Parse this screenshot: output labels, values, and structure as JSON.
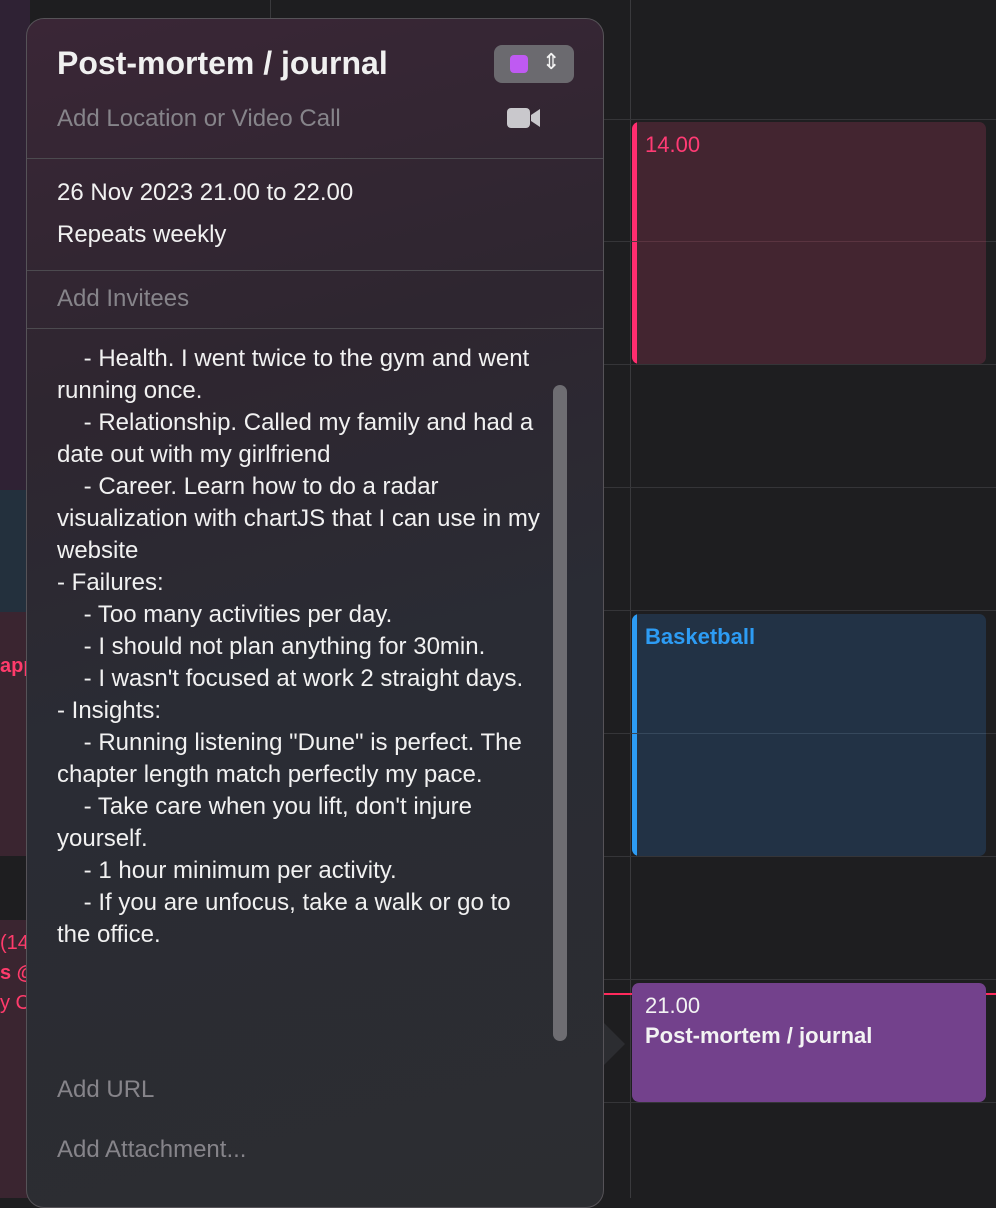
{
  "popover": {
    "title": "Post-mortem / journal",
    "calendar_color": "#bf5af2",
    "location_placeholder": "Add Location or Video Call",
    "date_time": "26 Nov 2023  21.00 to 22.00",
    "repeat": "Repeats weekly",
    "invitees_placeholder": "Add Invitees",
    "notes": "    - Health. I went twice to the gym and went running once.\n    - Relationship. Called my family and had a date out with my girlfriend\n    - Career. Learn how to do a radar visualization with chartJS that I can use in my website\n- Failures:\n    - Too many activities per day.\n    - I should not plan anything for 30min.\n    - I wasn't focused at work 2 straight days.\n- Insights:\n    - Running listening \"Dune\" is perfect. The chapter length match perfectly my pace.\n    - Take care when you lift, don't injure yourself.\n    - 1 hour minimum per activity.\n    - If you are unfocus, take a walk or go to the office.",
    "url_placeholder": "Add URL",
    "attachment_placeholder": "Add Attachment..."
  },
  "calendar": {
    "events": [
      {
        "time": "14.00",
        "title": "",
        "color": "#ff2d6f"
      },
      {
        "time": "",
        "title": "Basketball",
        "color": "#2d9cf4"
      },
      {
        "time": "21.00",
        "title": "Post-mortem / journal",
        "color": "#bf5af2"
      }
    ],
    "left_fragments": [
      "app",
      "(14",
      "s @",
      "y C"
    ]
  }
}
